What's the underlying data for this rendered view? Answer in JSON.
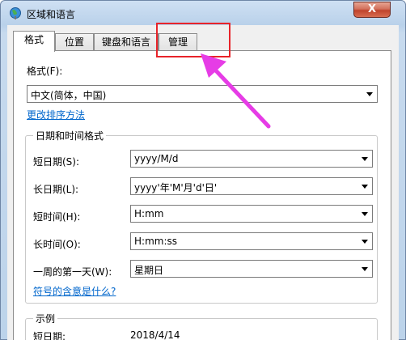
{
  "window": {
    "title": "区域和语言",
    "close_symbol": "X"
  },
  "tabs": [
    {
      "label": "格式",
      "active": true
    },
    {
      "label": "位置",
      "active": false
    },
    {
      "label": "键盘和语言",
      "active": false
    },
    {
      "label": "管理",
      "active": false
    }
  ],
  "format": {
    "label": "格式(F):",
    "value": "中文(简体，中国)",
    "link": "更改排序方法"
  },
  "datetime": {
    "group_title": "日期和时间格式",
    "rows": [
      {
        "label": "短日期(S):",
        "value": "yyyy/M/d"
      },
      {
        "label": "长日期(L):",
        "value": "yyyy'年'M'月'd'日'"
      },
      {
        "label": "短时间(H):",
        "value": "H:mm"
      },
      {
        "label": "长时间(O):",
        "value": "H:mm:ss"
      },
      {
        "label": "一周的第一天(W):",
        "value": "星期日"
      }
    ],
    "help_link": "符号的含意是什么?"
  },
  "example": {
    "group_title": "示例",
    "rows": [
      {
        "label": "短日期:",
        "value": "2018/4/14"
      }
    ]
  },
  "annotation": {
    "highlight_color": "#e8242a",
    "arrow_color": "#e63ce6"
  }
}
